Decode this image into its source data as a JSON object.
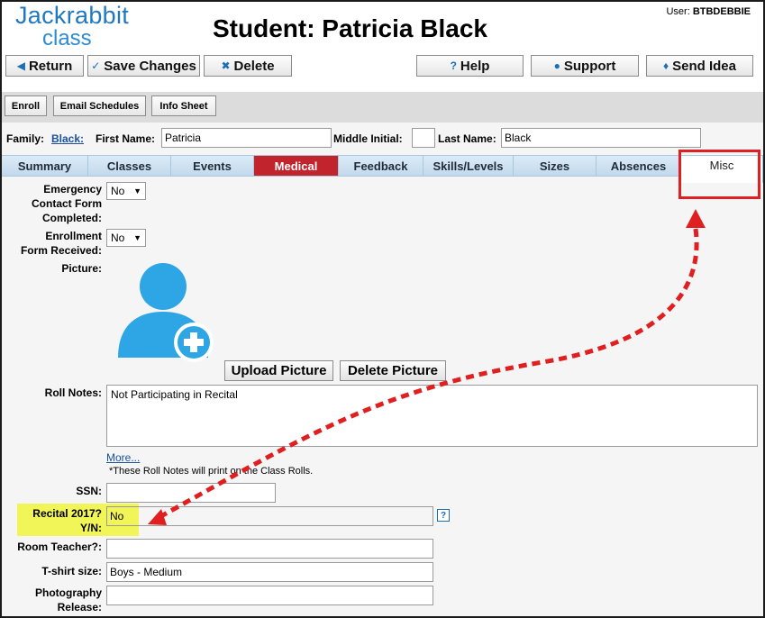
{
  "app": {
    "logo_line1": "Jackrabbit",
    "logo_line2": "class"
  },
  "header": {
    "title": "Student: Patricia Black",
    "user_label": "User:",
    "user_name": "BTBDEBBIE"
  },
  "toolbar": {
    "return": "Return",
    "save": "Save Changes",
    "delete": "Delete",
    "help": "Help",
    "support": "Support",
    "send_idea": "Send Idea"
  },
  "actions": {
    "enroll": "Enroll",
    "email_schedules": "Email Schedules",
    "info_sheet": "Info Sheet"
  },
  "name_row": {
    "family_label": "Family:",
    "family_link": "Black:",
    "first_name_label": "First Name:",
    "first_name": "Patricia",
    "middle_initial_label": "Middle Initial:",
    "middle_initial": "",
    "last_name_label": "Last Name:",
    "last_name": "Black"
  },
  "tabs": [
    "Summary",
    "Classes",
    "Events",
    "Medical",
    "Feedback",
    "Skills/Levels",
    "Sizes",
    "Absences",
    "Misc"
  ],
  "active_tab": "Medical",
  "form": {
    "emergency_label_1": "Emergency",
    "emergency_label_2": "Contact Form",
    "emergency_label_3": "Completed:",
    "emergency_value": "No",
    "enrollment_label_1": "Enrollment",
    "enrollment_label_2": "Form Received:",
    "enrollment_value": "No",
    "picture_label": "Picture:",
    "upload_picture": "Upload Picture",
    "delete_picture": "Delete Picture",
    "roll_notes_label": "Roll Notes:",
    "roll_notes_value": "Not Participating in Recital",
    "more_link": "More...",
    "roll_notes_hint": "*These Roll Notes will print on the Class Rolls.",
    "ssn_label": "SSN:",
    "ssn_value": "",
    "recital_label_1": "Recital 2017?",
    "recital_label_2": "Y/N:",
    "recital_value": "No",
    "room_teacher_label": "Room Teacher?:",
    "room_teacher_value": "",
    "tshirt_label": "T-shirt size:",
    "tshirt_value": "Boys - Medium",
    "photo_label_1": "Photography",
    "photo_label_2": "Release:",
    "photo_value": ""
  },
  "colors": {
    "accent_blue": "#1f78c2",
    "active_tab": "#c1242c",
    "annotation_red": "#e02020",
    "highlight_yellow": "#f2f558"
  }
}
